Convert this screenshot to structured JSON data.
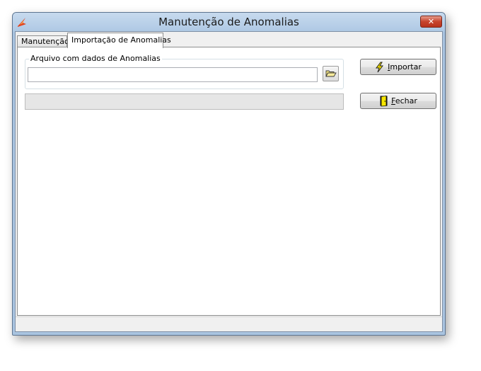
{
  "window": {
    "title": "Manutenção de Anomalias",
    "close_label": "✕"
  },
  "tabs": [
    {
      "label": "Manutenção",
      "active": false
    },
    {
      "label": "Importação de Anomalias",
      "active": true
    }
  ],
  "import_panel": {
    "group_label": "Arquivo com dados de Anomalias",
    "file_input": {
      "value": "",
      "placeholder": ""
    },
    "browse_icon": "folder-open-icon",
    "progress": 0
  },
  "buttons": {
    "import": {
      "access_key": "I",
      "rest": "mportar",
      "icon": "lightning-icon"
    },
    "close": {
      "access_key": "F",
      "rest": "echar",
      "icon": "exit-door-icon"
    }
  },
  "colors": {
    "titlebar": "#aec8e4",
    "close_button": "#c7432c",
    "lightning": "#f3e000",
    "door": "#f7e600"
  }
}
